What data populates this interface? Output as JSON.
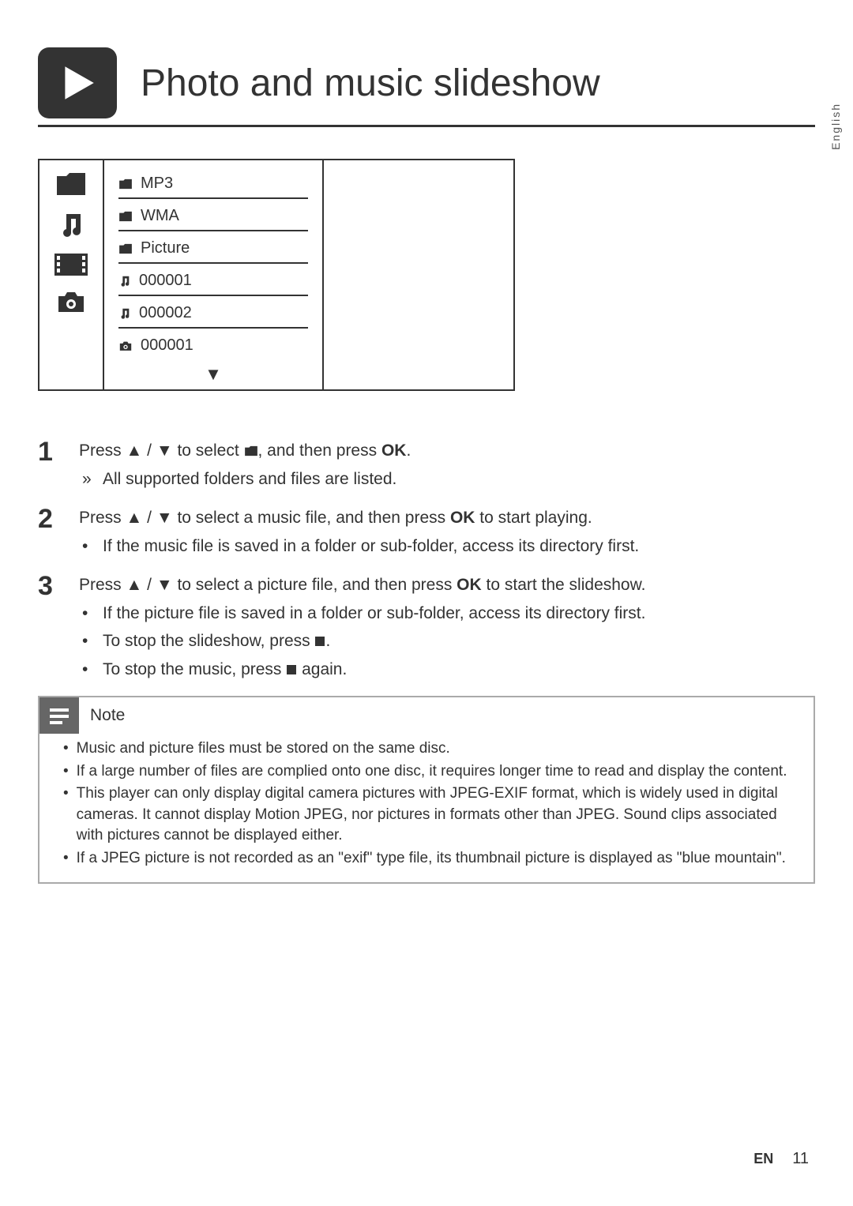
{
  "lang_side": "English",
  "header": {
    "title": "Photo and music slideshow"
  },
  "menu": {
    "items": {
      "mp3": "MP3",
      "wma": "WMA",
      "picture": "Picture",
      "t000001a": "000001",
      "t000002": "000002",
      "t000001b": "000001"
    }
  },
  "steps": {
    "s1": {
      "num": "1",
      "line_a": "Press ",
      "line_b": " / ",
      "line_c": " to select ",
      "line_d": ", and then press ",
      "ok": "OK",
      "line_e": ".",
      "sub1_marker": "»",
      "sub1": "All supported folders and files are listed."
    },
    "s2": {
      "num": "2",
      "line_a": "Press ",
      "line_b": " / ",
      "line_c": " to select a music file, and then press ",
      "ok": "OK",
      "line_d": " to start playing.",
      "sub1_marker": "•",
      "sub1": "If the music file is saved in a folder or sub-folder, access its directory first."
    },
    "s3": {
      "num": "3",
      "line_a": "Press ",
      "line_b": " / ",
      "line_c": " to select a picture file, and then press ",
      "ok": "OK",
      "line_d": " to start the slideshow.",
      "sub1_marker": "•",
      "sub1": "If the picture file is saved in a folder or sub-folder, access its directory first.",
      "sub2_marker": "•",
      "sub2a": "To stop the slideshow, press ",
      "sub2b": ".",
      "sub3_marker": "•",
      "sub3a": "To stop the music, press ",
      "sub3b": " again."
    }
  },
  "note": {
    "title": "Note",
    "items": {
      "n1": "Music and picture files must be stored on the same disc.",
      "n2": "If a large number of files are complied onto one disc, it requires longer time to read and display the content.",
      "n3": "This player can only display digital camera pictures with JPEG-EXIF format, which is widely used in digital cameras. It cannot display Motion JPEG, nor pictures in formats other than JPEG. Sound clips associated with pictures cannot be displayed either.",
      "n4": "If a JPEG picture is not recorded as an \"exif\" type file, its thumbnail picture is displayed as \"blue mountain\"."
    }
  },
  "footer": {
    "lang": "EN",
    "page": "11"
  }
}
